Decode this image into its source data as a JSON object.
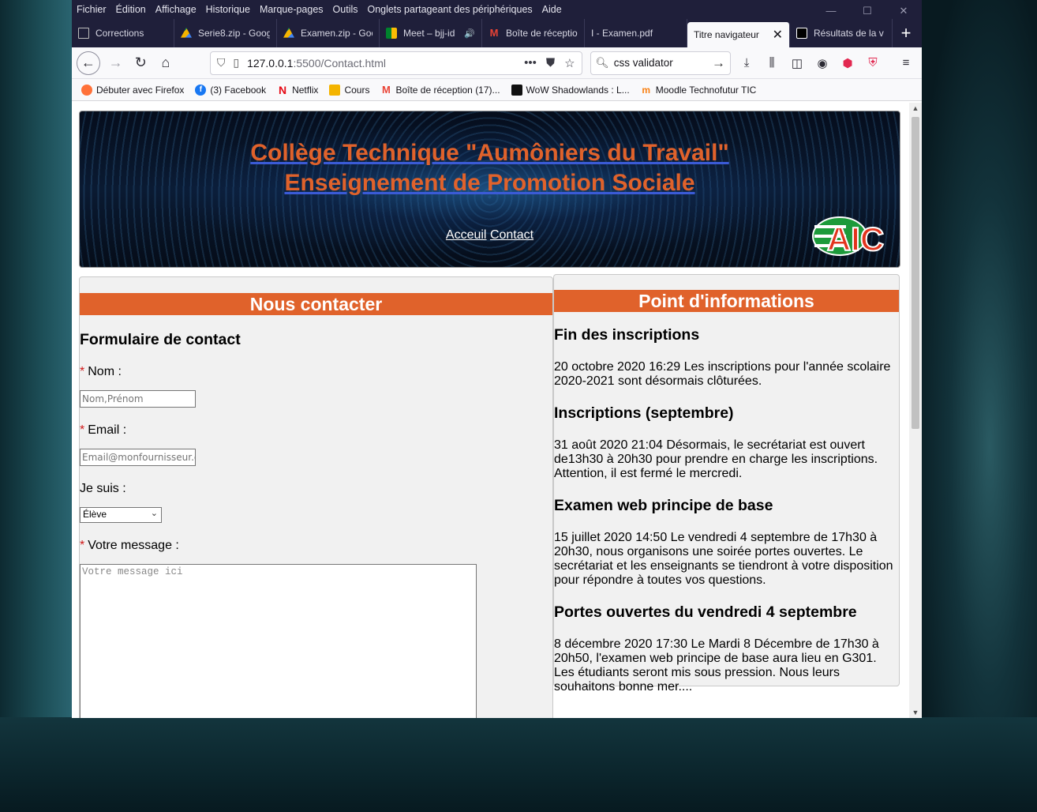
{
  "menu": [
    "Fichier",
    "Édition",
    "Affichage",
    "Historique",
    "Marque-pages",
    "Outils",
    "Onglets partageant des périphériques",
    "Aide"
  ],
  "window_controls": [
    "—",
    "☐",
    "✕"
  ],
  "tabs": [
    {
      "label": "Corrections",
      "icon": "page-icon"
    },
    {
      "label": "Serie8.zip - Goog",
      "icon": "google-drive-icon"
    },
    {
      "label": "Examen.zip - Goo",
      "icon": "google-drive-icon"
    },
    {
      "label": "Meet – bjj-id",
      "icon": "google-meet-icon"
    },
    {
      "label": "Boîte de réceptio",
      "icon": "gmail-icon"
    },
    {
      "label": "I - Examen.pdf",
      "icon": "pdf-icon"
    },
    {
      "label": "Titre navigateur",
      "icon": "none"
    },
    {
      "label": "Résultats de la v",
      "icon": "w3c-icon"
    }
  ],
  "url": {
    "host": "127.0.0.1",
    "path": ":5500/Contact.html"
  },
  "search": {
    "query": "css validator"
  },
  "bookmarks": [
    {
      "label": "Débuter avec Firefox",
      "icon": "firefox-icon",
      "color": "#ff7139"
    },
    {
      "label": "(3) Facebook",
      "icon": "facebook-icon",
      "color": "#1877f2"
    },
    {
      "label": "Netflix",
      "icon": "netflix-icon",
      "color": "#e50914"
    },
    {
      "label": "Cours",
      "icon": "folder-icon",
      "color": "#f4b400"
    },
    {
      "label": "Boîte de réception (17)...",
      "icon": "gmail-icon",
      "color": "#ea4335"
    },
    {
      "label": "WoW Shadowlands : L...",
      "icon": "wow-icon",
      "color": "#111111"
    },
    {
      "label": "Moodle Technofutur TIC",
      "icon": "moodle-icon",
      "color": "#f98012"
    }
  ],
  "page": {
    "title_line1": "Collège Technique \"Aumôniers du Travail\"",
    "title_line2": "Enseignement de Promotion Sociale",
    "nav": [
      "Acceuil",
      "Contact"
    ],
    "logo_text": "AIC",
    "contact": {
      "header": "Nous contacter",
      "form_title": "Formulaire de contact",
      "required_mark": "*",
      "name_label": "Nom :",
      "name_placeholder": "Nom,Prénom",
      "email_label": "Email :",
      "email_placeholder": "Email@monfournisseur.com",
      "role_label": "Je suis :",
      "role_value": "Élève",
      "message_label": "Votre message :",
      "message_placeholder": "Votre message ici"
    },
    "info": {
      "header": "Point d'informations",
      "items": [
        {
          "title": "Fin des inscriptions",
          "text": "20 octobre 2020 16:29 Les inscriptions pour l'année scolaire 2020-2021 sont désormais clôturées."
        },
        {
          "title": "Inscriptions (septembre)",
          "text": "31 août 2020 21:04 Désormais, le secrétariat est ouvert de13h30 à 20h30 pour prendre en charge les inscriptions. Attention, il est fermé le mercredi."
        },
        {
          "title": "Examen web principe de base",
          "text": "15 juillet 2020 14:50 Le vendredi 4 septembre de 17h30 à 20h30, nous organisons une soirée portes ouvertes. Le secrétariat et les enseignants se tiendront à votre disposition pour répondre à toutes vos questions."
        },
        {
          "title": "Portes ouvertes du vendredi 4 septembre",
          "text": "8 décembre 2020 17:30 Le Mardi 8 Décembre de 17h30 à 20h50, l'examen web principe de base aura lieu en G301. Les étudiants seront mis sous pression. Nous leurs souhaitons bonne mer...."
        }
      ]
    }
  },
  "colors": {
    "accent": "#e0622b",
    "chrome_dark": "#1f1f3a",
    "required": "#d01818"
  }
}
